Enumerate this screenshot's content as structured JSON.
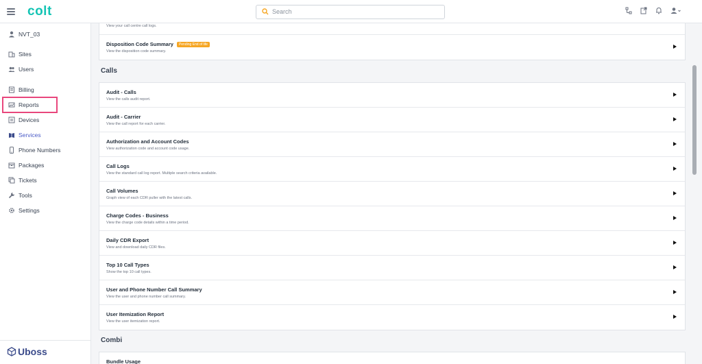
{
  "app": {
    "logo": "colt",
    "brand": "Uboss"
  },
  "search": {
    "placeholder": "Search"
  },
  "sidebar": {
    "account": "NVT_03",
    "items": [
      {
        "label": "Sites"
      },
      {
        "label": "Users"
      },
      {
        "label": "Billing"
      },
      {
        "label": "Reports"
      },
      {
        "label": "Devices"
      },
      {
        "label": "Services"
      },
      {
        "label": "Phone Numbers"
      },
      {
        "label": "Packages"
      },
      {
        "label": "Tickets"
      },
      {
        "label": "Tools"
      },
      {
        "label": "Settings"
      }
    ]
  },
  "top_partial": {
    "prev_desc": "View your call centre call logs.",
    "title": "Disposition Code Summary",
    "badge": "Pending End of life",
    "desc": "View the disposition code summary."
  },
  "calls": {
    "title": "Calls",
    "rows": [
      {
        "title": "Audit - Calls",
        "desc": "View the calls audit report."
      },
      {
        "title": "Audit - Carrier",
        "desc": "View the call report for each carrier."
      },
      {
        "title": "Authorization and Account Codes",
        "desc": "View authorization code and account code usage."
      },
      {
        "title": "Call Logs",
        "desc": "View the standard call log report. Multiple search criteria available."
      },
      {
        "title": "Call Volumes",
        "desc": "Graph view of each CDR puller with the latest calls."
      },
      {
        "title": "Charge Codes - Business",
        "desc": "View the charge code details within a time period."
      },
      {
        "title": "Daily CDR Export",
        "desc": "View and download daily CDR files."
      },
      {
        "title": "Top 10 Call Types",
        "desc": "Show the top 10 call types."
      },
      {
        "title": "User and Phone Number Call Summary",
        "desc": "View the user and phone number call summary."
      },
      {
        "title": "User Itemization Report",
        "desc": "View the user itemization report."
      }
    ]
  },
  "combi": {
    "title": "Combi",
    "rows": [
      {
        "title": "Bundle Usage"
      }
    ]
  },
  "colors": {
    "accent": "#14c4b4",
    "highlight": "#e8467c",
    "badge": "#f6a623",
    "active": "#4a5bc7"
  }
}
